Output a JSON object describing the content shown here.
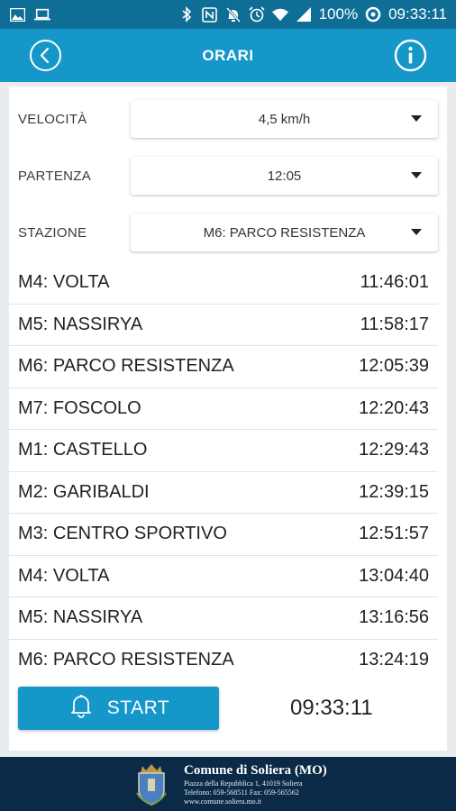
{
  "status_bar": {
    "battery": "100%",
    "time": "09:33:11",
    "icons_left": [
      "image-icon",
      "laptop-icon"
    ],
    "icons_right": [
      "bluetooth-icon",
      "nfc-icon",
      "mute-icon",
      "alarm-icon",
      "wifi-icon",
      "signal-icon",
      "data-saver-icon"
    ]
  },
  "app_bar": {
    "title": "ORARI",
    "back_icon": "back-circle-icon",
    "info_icon": "info-circle-icon"
  },
  "filters": {
    "speed": {
      "label": "VELOCITÀ",
      "value": "4,5 km/h"
    },
    "departure": {
      "label": "PARTENZA",
      "value": "12:05"
    },
    "station": {
      "label": "STAZIONE",
      "value": "M6: PARCO RESISTENZA"
    }
  },
  "schedule": [
    {
      "stop": "M4: VOLTA",
      "time": "11:46:01"
    },
    {
      "stop": "M5: NASSIRYA",
      "time": "11:58:17"
    },
    {
      "stop": "M6: PARCO RESISTENZA",
      "time": "12:05:39"
    },
    {
      "stop": "M7: FOSCOLO",
      "time": "12:20:43"
    },
    {
      "stop": "M1: CASTELLO",
      "time": "12:29:43"
    },
    {
      "stop": "M2: GARIBALDI",
      "time": "12:39:15"
    },
    {
      "stop": "M3: CENTRO SPORTIVO",
      "time": "12:51:57"
    },
    {
      "stop": "M4: VOLTA",
      "time": "13:04:40"
    },
    {
      "stop": "M5: NASSIRYA",
      "time": "13:16:56"
    },
    {
      "stop": "M6: PARCO RESISTENZA",
      "time": "13:24:19"
    }
  ],
  "action": {
    "start_label": "START",
    "start_icon": "bell-icon",
    "clock": "09:33:11"
  },
  "footer": {
    "title": "Comune di Soliera (MO)",
    "address": "Piazza della Repubblica 1, 41019 Soliera",
    "phone": "Telefono: 059-568511 Fax: 059-565562",
    "web": "www.comune.soliera.mo.it"
  },
  "colors": {
    "status_bar": "#0f6e96",
    "app_bar": "#1597c9",
    "accent": "#1597c9",
    "footer": "#0b2a47",
    "background": "#e9ecee"
  }
}
